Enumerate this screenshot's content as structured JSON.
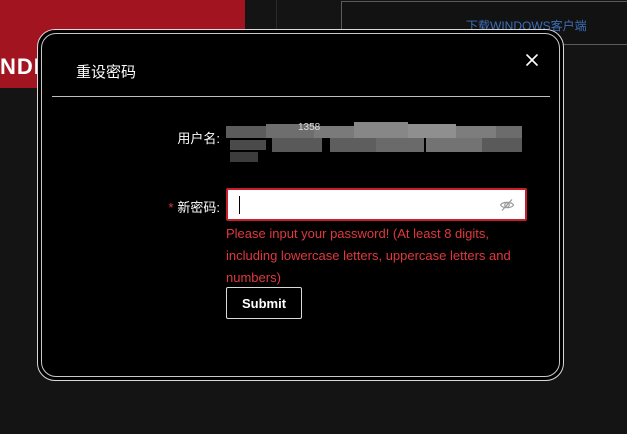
{
  "background": {
    "app_text": "NDI",
    "download_link": "下载WINDOWS客户端",
    "colors": {
      "brand_red": "#a31421",
      "link_blue": "#3d6fb8"
    }
  },
  "modal": {
    "title": "重设密码",
    "close_icon": "close-icon",
    "form": {
      "username_label": "用户名:",
      "username_value_partial": "1358",
      "password_required_mark": "*",
      "password_label": "新密码:",
      "password_value": "",
      "password_visibility_icon": "eye-off-icon",
      "error_message": "Please input your password! (At least 8 digits, including lowercase letters, uppercase letters and numbers)",
      "submit_label": "Submit"
    },
    "colors": {
      "error": "#e0383e",
      "input_border": "#c7202c"
    }
  }
}
